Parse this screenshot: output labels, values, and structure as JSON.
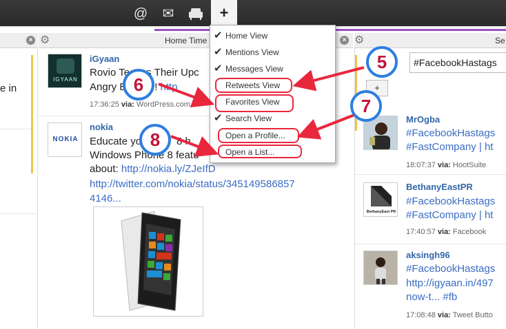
{
  "topbar": {
    "icons": [
      "at-icon",
      "envelope-icon",
      "armchair-icon"
    ],
    "at_glyph": "@",
    "mail_glyph": "✉",
    "plus_glyph": "+"
  },
  "columns": {
    "middle_header": "Home Time",
    "right_header": "Se",
    "left_text": "e in"
  },
  "menu": {
    "items": [
      {
        "label": "Home View",
        "checked": true
      },
      {
        "label": "Mentions View",
        "checked": true
      },
      {
        "label": "Messages View",
        "checked": true
      },
      {
        "label": "Retweets View",
        "checked": false
      },
      {
        "label": "Favorites View",
        "checked": false
      },
      {
        "label": "Search View",
        "checked": true
      },
      {
        "label": "Open a Profile...",
        "checked": false
      },
      {
        "label": "Open a List...",
        "checked": false
      }
    ]
  },
  "badges": {
    "b5": "5",
    "b6": "6",
    "b7": "7",
    "b8": "8"
  },
  "tweets": [
    {
      "user": "iGyaan",
      "avatar_text": "IGYAAN",
      "line1": "Rovio Teases Their Upc",
      "line2a": "Angry Bird Go! ",
      "line2b": "http",
      "time": "17:36:25",
      "via_label": "via:",
      "source": "WordPress.com"
    },
    {
      "user": "nokia",
      "avatar_text": "NOKIA",
      "line1": "Educate yo",
      "line1b": "self, y",
      "line1c": "8 h",
      "line2": "Windows Phone 8 featu",
      "line3a": "about: ",
      "line3b": "http://nokia.ly/ZJeIfD",
      "line4": "http://twitter.com/nokia/status/345149586857",
      "line5": "4146..."
    }
  ],
  "search": {
    "value": "#FacebookHastags",
    "add_label": "+"
  },
  "right_tweets": [
    {
      "user": "MrOgba",
      "line1": "#FacebookHastags",
      "line2": "#FastCompany",
      "line2b": " | ht",
      "time": "18:07:37",
      "via_label": "via:",
      "source": "HootSuite"
    },
    {
      "user": "BethanyEastPR",
      "avatar_text": "BethanyEast PR",
      "line1": "#FacebookHastags",
      "line2": "#FastCompany",
      "line2b": " | ht",
      "time": "17:40:57",
      "via_label": "via:",
      "source": "Facebook"
    },
    {
      "user": "aksingh96",
      "line1": "#FacebookHastags",
      "line2": "http://igyaan.in/497",
      "line3": "now-t... ",
      "line3b": "#fb",
      "time": "17:08:48",
      "via_label": "via:",
      "source": "Tweet Butto"
    }
  ],
  "colors": {
    "accent_purple": "#9a4fc4",
    "highlight_red": "#e8273d",
    "badge_blue": "#2e7fe0",
    "link_blue": "#3a6cc4"
  }
}
